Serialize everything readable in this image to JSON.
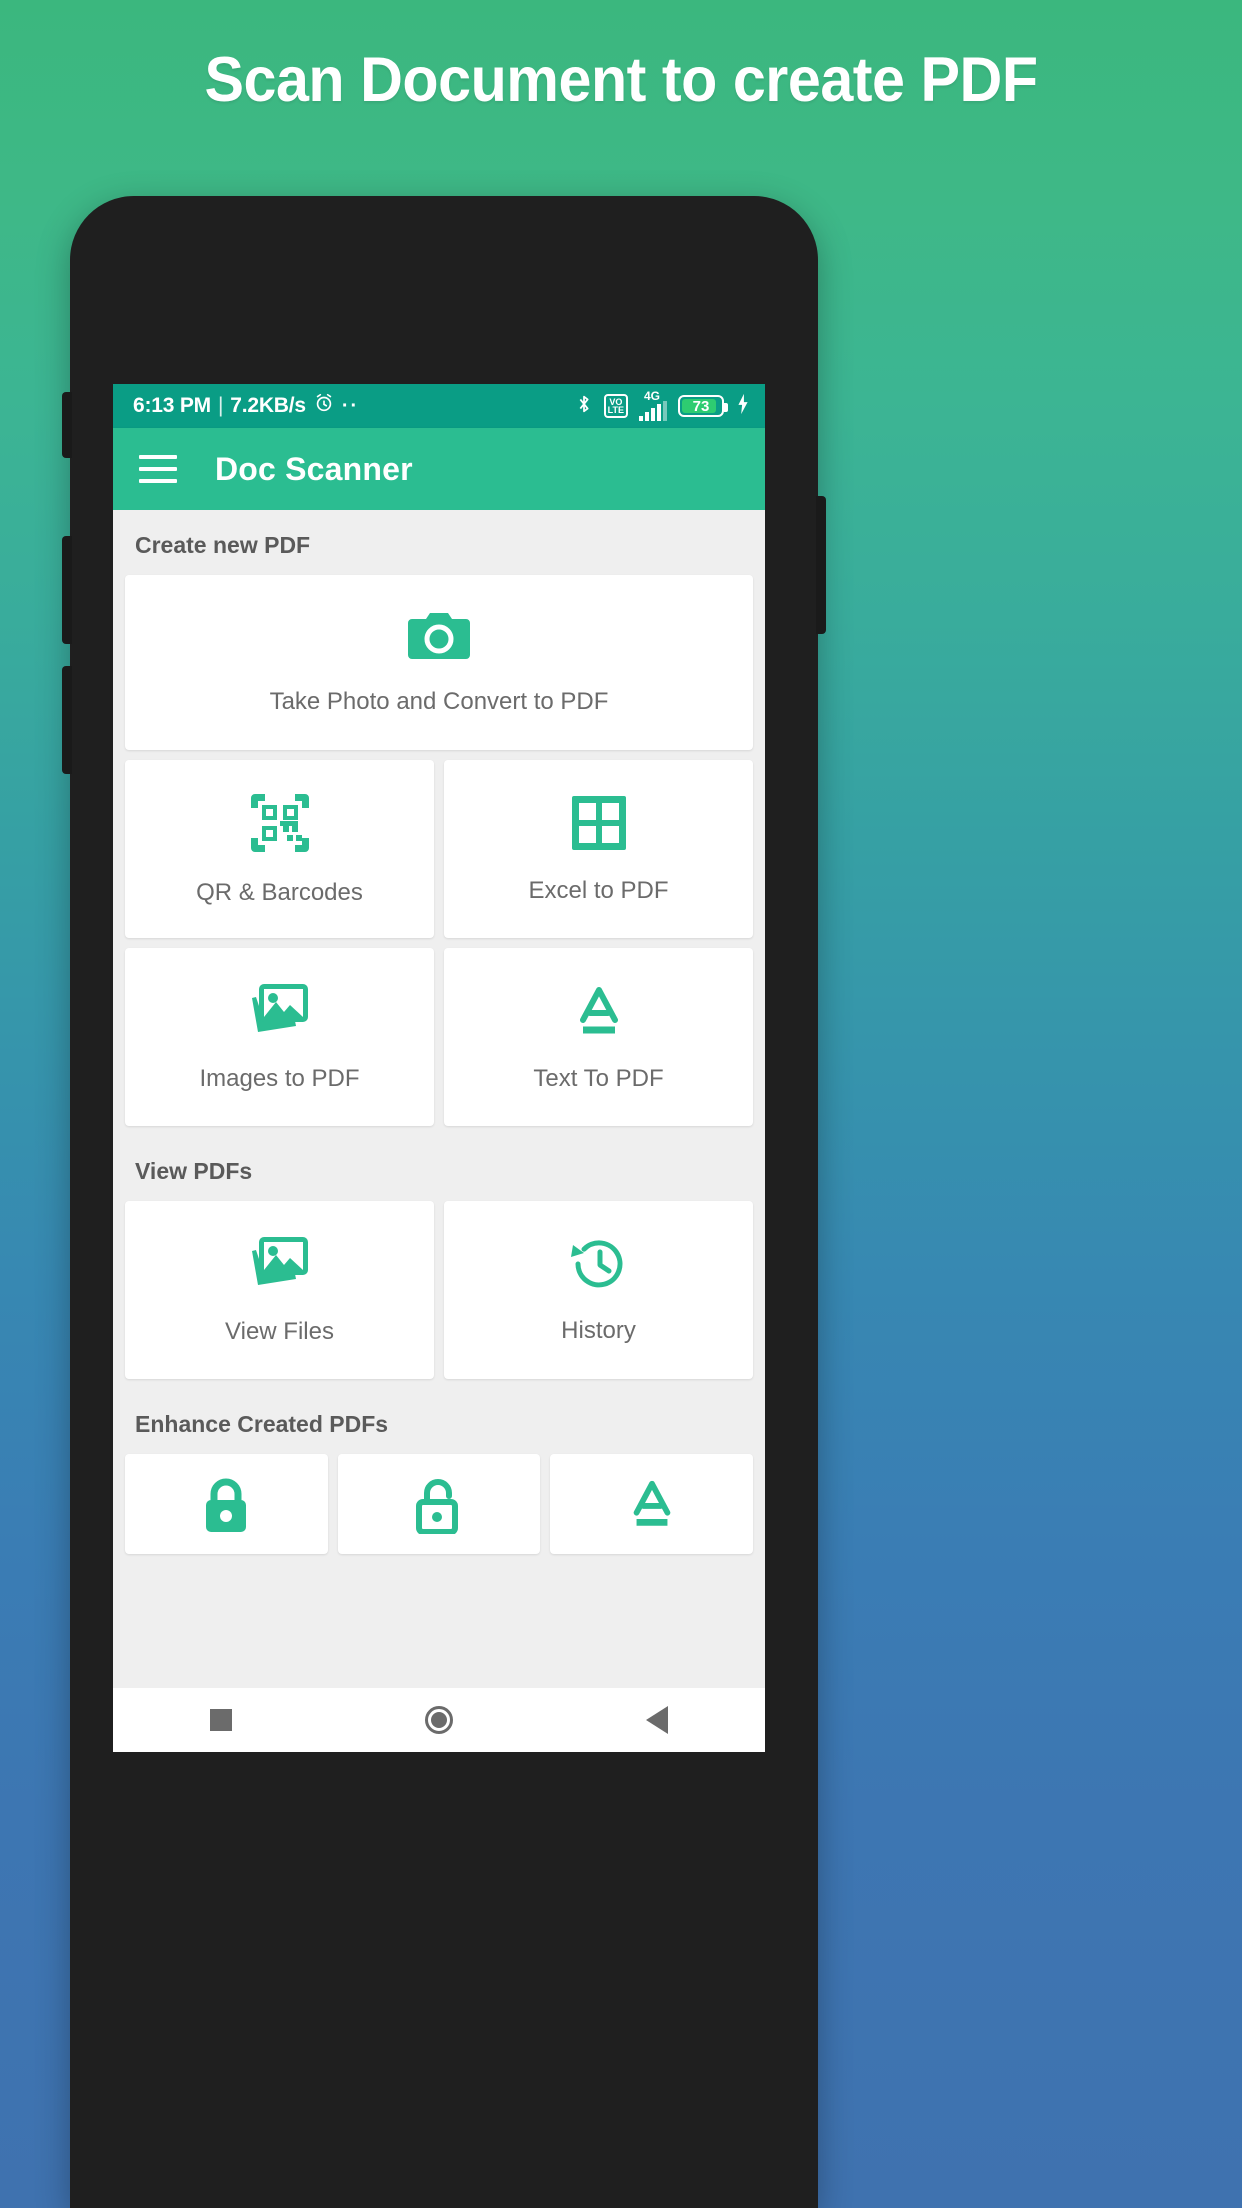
{
  "promo": {
    "headline": "Scan Document to create PDF",
    "bg_top_color": "#3bb77e",
    "bg_bottom_color": "#3f72af"
  },
  "statusbar": {
    "time": "6:13 PM",
    "separator": "|",
    "network_speed": "7.2KB/s",
    "alarm_icon": "alarm-clock-icon",
    "dots": "··",
    "bluetooth_icon": "bluetooth-icon",
    "volte_top": "VO",
    "volte_bottom": "LTE",
    "network_type": "4G",
    "battery_percent": "73",
    "charging_icon": "charging-bolt-icon",
    "bg_color": "#0a9d85"
  },
  "appbar": {
    "menu_icon": "hamburger-menu-icon",
    "title": "Doc Scanner",
    "bg_color": "#2bbd91"
  },
  "accent_color": "#2bbd91",
  "sections": [
    {
      "title": "Create new PDF",
      "wide_card": {
        "label": "Take Photo and Convert to PDF",
        "icon": "camera-icon"
      },
      "grid": [
        {
          "label": "QR & Barcodes",
          "icon": "qr-code-icon"
        },
        {
          "label": "Excel to PDF",
          "icon": "grid-table-icon"
        },
        {
          "label": "Images to PDF",
          "icon": "images-stack-icon"
        },
        {
          "label": "Text To PDF",
          "icon": "text-a-underline-icon"
        }
      ]
    },
    {
      "title": "View PDFs",
      "grid": [
        {
          "label": "View Files",
          "icon": "images-stack-icon"
        },
        {
          "label": "History",
          "icon": "history-clock-icon"
        }
      ]
    },
    {
      "title": "Enhance Created PDFs",
      "grid": [
        {
          "label": "",
          "icon": "lock-closed-icon"
        },
        {
          "label": "",
          "icon": "lock-open-icon"
        },
        {
          "label": "",
          "icon": "text-a-underline-icon"
        }
      ]
    }
  ],
  "navbar": {
    "recents": "recents-square-icon",
    "home": "home-circle-icon",
    "back": "back-triangle-icon"
  }
}
